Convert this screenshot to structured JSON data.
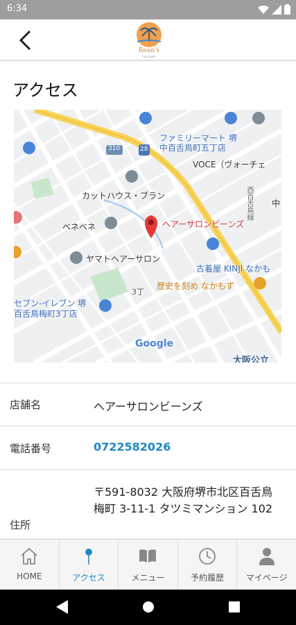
{
  "status_bar": {
    "time": "6:34"
  },
  "header": {
    "logo_text": "Bean's",
    "logo_sub": "hair salon"
  },
  "section_title": "アクセス",
  "map": {
    "labels": {
      "family_mart": "ファミリーマート 堺\n中百舌鳥町五丁店",
      "voce": "VOCE（ヴォーチェ",
      "cut_house": "カットハウス・ブラン",
      "bebe": "ベネベネ",
      "salon": "ヘアーサロンビーンズ",
      "yamato": "ヤマトヘアーサロン",
      "kinji": "古着屋 KINJI なかも",
      "history": "歴史を刻め なかもず",
      "seven": "セブン-イレブン 堺\n百舌鳥梅町3丁店",
      "google": "Google",
      "osaka": "大阪公立",
      "road310": "310",
      "road28": "28",
      "sanchome": "3丁",
      "nishi": "西百舌鳥線",
      "naka": "中"
    }
  },
  "info": {
    "store_label": "店舗名",
    "store_value": "ヘアーサロンビーンズ",
    "phone_label": "電話番号",
    "phone_value": "0722582026",
    "address_label": "住所",
    "address_value": "〒591-8032 大阪府堺市北区百舌鳥梅町 3-11-1 タツミマンション 102"
  },
  "bottom_nav": {
    "items": [
      {
        "label": "HOME",
        "icon": "home-icon"
      },
      {
        "label": "アクセス",
        "icon": "pin-icon"
      },
      {
        "label": "メニュー",
        "icon": "book-icon"
      },
      {
        "label": "予約履歴",
        "icon": "clock-icon"
      },
      {
        "label": "マイページ",
        "icon": "person-icon"
      }
    ],
    "active_index": 1
  },
  "colors": {
    "accent": "#1e88c7",
    "map_pin": "#e53935",
    "road_yellow": "#f7d358"
  }
}
